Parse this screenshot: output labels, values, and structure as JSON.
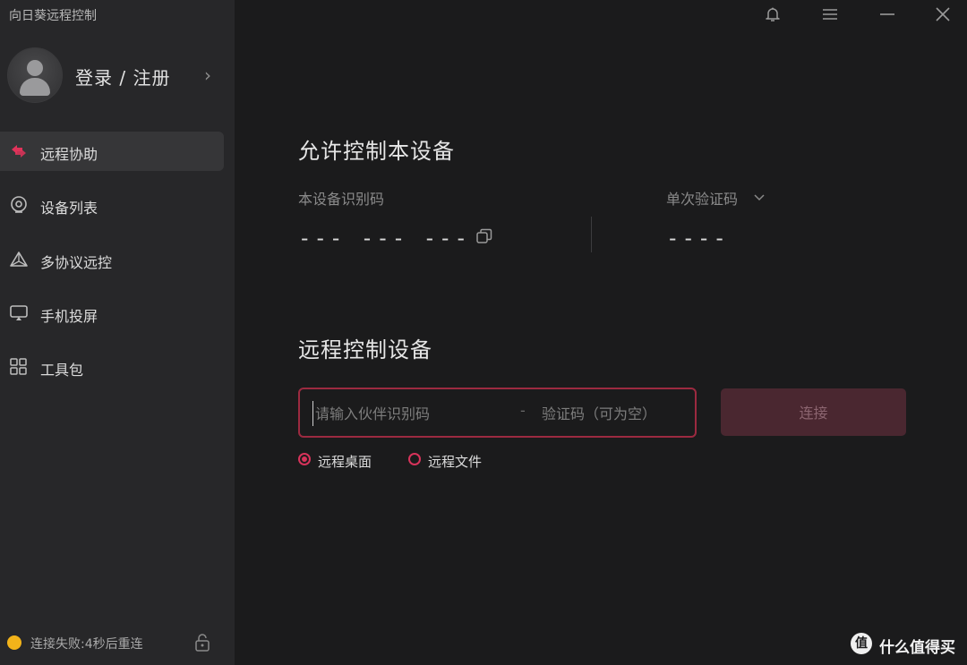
{
  "app": {
    "title": "向日葵远程控制"
  },
  "profile": {
    "login_label": "登录 / 注册",
    "chevron": "›"
  },
  "sidebar": {
    "items": [
      {
        "label": "远程协助",
        "icon": "remote-assist-icon",
        "active": true
      },
      {
        "label": "设备列表",
        "icon": "device-list-icon"
      },
      {
        "label": "多协议远控",
        "icon": "multi-protocol-icon"
      },
      {
        "label": "手机投屏",
        "icon": "screen-cast-icon"
      },
      {
        "label": "工具包",
        "icon": "toolbox-icon"
      }
    ],
    "status": {
      "text": "连接失败:4秒后重连",
      "color": "#f2b31a"
    }
  },
  "allow_control": {
    "title": "允许控制本设备",
    "device_id_label": "本设备识别码",
    "device_id_value": "--- --- ---",
    "verify_label": "单次验证码",
    "verify_value": "----"
  },
  "remote_control": {
    "title": "远程控制设备",
    "partner_placeholder": "请输入伙伴识别码",
    "separator": "-",
    "verify_placeholder": "验证码（可为空）",
    "connect_label": "连接",
    "modes": [
      {
        "label": "远程桌面",
        "checked": true
      },
      {
        "label": "远程文件",
        "checked": false
      }
    ]
  },
  "watermark": {
    "badge": "值",
    "text": "什么值得买"
  },
  "colors": {
    "accent": "#d7335a",
    "sidebar_bg": "#272729",
    "main_bg": "#1b1b1c",
    "status_dot": "#f2b31a"
  }
}
